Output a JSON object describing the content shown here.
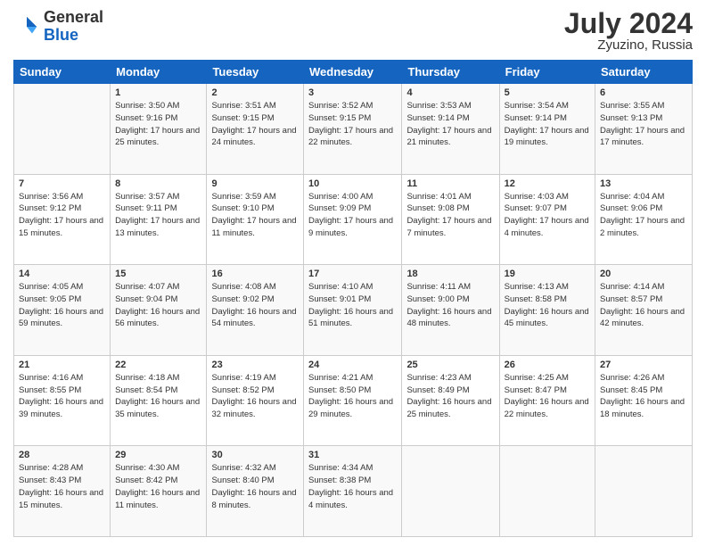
{
  "header": {
    "logo_general": "General",
    "logo_blue": "Blue",
    "month_year": "July 2024",
    "location": "Zyuzino, Russia"
  },
  "days_of_week": [
    "Sunday",
    "Monday",
    "Tuesday",
    "Wednesday",
    "Thursday",
    "Friday",
    "Saturday"
  ],
  "weeks": [
    [
      {
        "day": "",
        "sunrise": "",
        "sunset": "",
        "daylight": ""
      },
      {
        "day": "1",
        "sunrise": "Sunrise: 3:50 AM",
        "sunset": "Sunset: 9:16 PM",
        "daylight": "Daylight: 17 hours and 25 minutes."
      },
      {
        "day": "2",
        "sunrise": "Sunrise: 3:51 AM",
        "sunset": "Sunset: 9:15 PM",
        "daylight": "Daylight: 17 hours and 24 minutes."
      },
      {
        "day": "3",
        "sunrise": "Sunrise: 3:52 AM",
        "sunset": "Sunset: 9:15 PM",
        "daylight": "Daylight: 17 hours and 22 minutes."
      },
      {
        "day": "4",
        "sunrise": "Sunrise: 3:53 AM",
        "sunset": "Sunset: 9:14 PM",
        "daylight": "Daylight: 17 hours and 21 minutes."
      },
      {
        "day": "5",
        "sunrise": "Sunrise: 3:54 AM",
        "sunset": "Sunset: 9:14 PM",
        "daylight": "Daylight: 17 hours and 19 minutes."
      },
      {
        "day": "6",
        "sunrise": "Sunrise: 3:55 AM",
        "sunset": "Sunset: 9:13 PM",
        "daylight": "Daylight: 17 hours and 17 minutes."
      }
    ],
    [
      {
        "day": "7",
        "sunrise": "Sunrise: 3:56 AM",
        "sunset": "Sunset: 9:12 PM",
        "daylight": "Daylight: 17 hours and 15 minutes."
      },
      {
        "day": "8",
        "sunrise": "Sunrise: 3:57 AM",
        "sunset": "Sunset: 9:11 PM",
        "daylight": "Daylight: 17 hours and 13 minutes."
      },
      {
        "day": "9",
        "sunrise": "Sunrise: 3:59 AM",
        "sunset": "Sunset: 9:10 PM",
        "daylight": "Daylight: 17 hours and 11 minutes."
      },
      {
        "day": "10",
        "sunrise": "Sunrise: 4:00 AM",
        "sunset": "Sunset: 9:09 PM",
        "daylight": "Daylight: 17 hours and 9 minutes."
      },
      {
        "day": "11",
        "sunrise": "Sunrise: 4:01 AM",
        "sunset": "Sunset: 9:08 PM",
        "daylight": "Daylight: 17 hours and 7 minutes."
      },
      {
        "day": "12",
        "sunrise": "Sunrise: 4:03 AM",
        "sunset": "Sunset: 9:07 PM",
        "daylight": "Daylight: 17 hours and 4 minutes."
      },
      {
        "day": "13",
        "sunrise": "Sunrise: 4:04 AM",
        "sunset": "Sunset: 9:06 PM",
        "daylight": "Daylight: 17 hours and 2 minutes."
      }
    ],
    [
      {
        "day": "14",
        "sunrise": "Sunrise: 4:05 AM",
        "sunset": "Sunset: 9:05 PM",
        "daylight": "Daylight: 16 hours and 59 minutes."
      },
      {
        "day": "15",
        "sunrise": "Sunrise: 4:07 AM",
        "sunset": "Sunset: 9:04 PM",
        "daylight": "Daylight: 16 hours and 56 minutes."
      },
      {
        "day": "16",
        "sunrise": "Sunrise: 4:08 AM",
        "sunset": "Sunset: 9:02 PM",
        "daylight": "Daylight: 16 hours and 54 minutes."
      },
      {
        "day": "17",
        "sunrise": "Sunrise: 4:10 AM",
        "sunset": "Sunset: 9:01 PM",
        "daylight": "Daylight: 16 hours and 51 minutes."
      },
      {
        "day": "18",
        "sunrise": "Sunrise: 4:11 AM",
        "sunset": "Sunset: 9:00 PM",
        "daylight": "Daylight: 16 hours and 48 minutes."
      },
      {
        "day": "19",
        "sunrise": "Sunrise: 4:13 AM",
        "sunset": "Sunset: 8:58 PM",
        "daylight": "Daylight: 16 hours and 45 minutes."
      },
      {
        "day": "20",
        "sunrise": "Sunrise: 4:14 AM",
        "sunset": "Sunset: 8:57 PM",
        "daylight": "Daylight: 16 hours and 42 minutes."
      }
    ],
    [
      {
        "day": "21",
        "sunrise": "Sunrise: 4:16 AM",
        "sunset": "Sunset: 8:55 PM",
        "daylight": "Daylight: 16 hours and 39 minutes."
      },
      {
        "day": "22",
        "sunrise": "Sunrise: 4:18 AM",
        "sunset": "Sunset: 8:54 PM",
        "daylight": "Daylight: 16 hours and 35 minutes."
      },
      {
        "day": "23",
        "sunrise": "Sunrise: 4:19 AM",
        "sunset": "Sunset: 8:52 PM",
        "daylight": "Daylight: 16 hours and 32 minutes."
      },
      {
        "day": "24",
        "sunrise": "Sunrise: 4:21 AM",
        "sunset": "Sunset: 8:50 PM",
        "daylight": "Daylight: 16 hours and 29 minutes."
      },
      {
        "day": "25",
        "sunrise": "Sunrise: 4:23 AM",
        "sunset": "Sunset: 8:49 PM",
        "daylight": "Daylight: 16 hours and 25 minutes."
      },
      {
        "day": "26",
        "sunrise": "Sunrise: 4:25 AM",
        "sunset": "Sunset: 8:47 PM",
        "daylight": "Daylight: 16 hours and 22 minutes."
      },
      {
        "day": "27",
        "sunrise": "Sunrise: 4:26 AM",
        "sunset": "Sunset: 8:45 PM",
        "daylight": "Daylight: 16 hours and 18 minutes."
      }
    ],
    [
      {
        "day": "28",
        "sunrise": "Sunrise: 4:28 AM",
        "sunset": "Sunset: 8:43 PM",
        "daylight": "Daylight: 16 hours and 15 minutes."
      },
      {
        "day": "29",
        "sunrise": "Sunrise: 4:30 AM",
        "sunset": "Sunset: 8:42 PM",
        "daylight": "Daylight: 16 hours and 11 minutes."
      },
      {
        "day": "30",
        "sunrise": "Sunrise: 4:32 AM",
        "sunset": "Sunset: 8:40 PM",
        "daylight": "Daylight: 16 hours and 8 minutes."
      },
      {
        "day": "31",
        "sunrise": "Sunrise: 4:34 AM",
        "sunset": "Sunset: 8:38 PM",
        "daylight": "Daylight: 16 hours and 4 minutes."
      },
      {
        "day": "",
        "sunrise": "",
        "sunset": "",
        "daylight": ""
      },
      {
        "day": "",
        "sunrise": "",
        "sunset": "",
        "daylight": ""
      },
      {
        "day": "",
        "sunrise": "",
        "sunset": "",
        "daylight": ""
      }
    ]
  ]
}
